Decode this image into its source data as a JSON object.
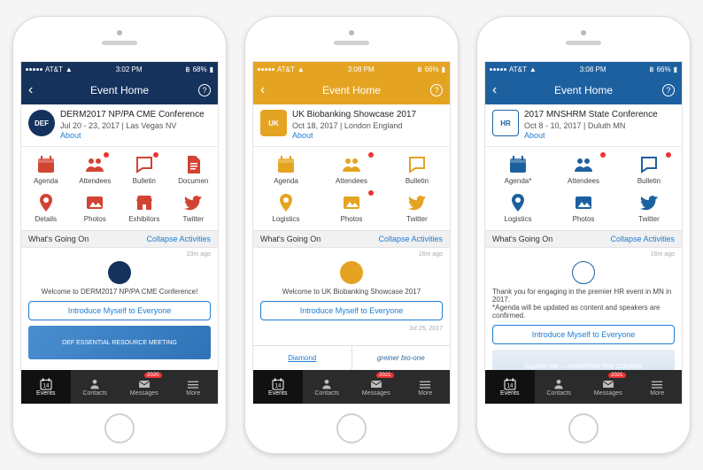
{
  "phones": [
    {
      "accent": "#15325c",
      "iconColor": "#d14433",
      "status": {
        "carrier": "AT&T",
        "time": "3:02 PM",
        "battery": "68%"
      },
      "navTitle": "Event Home",
      "event": {
        "title": "DERM2017 NP/PA CME Conference",
        "dates": "Jul 20 - 23, 2017 | Las Vegas NV",
        "about": "About",
        "logoText": "DEF",
        "logoBg": "#15325c",
        "logoShape": "circle"
      },
      "grid": [
        {
          "name": "agenda",
          "label": "Agenda",
          "badge": false
        },
        {
          "name": "attendees",
          "label": "Attendees",
          "badge": true
        },
        {
          "name": "bulletin",
          "label": "Bulletin",
          "badge": true
        },
        {
          "name": "documents",
          "label": "Documen",
          "badge": false
        },
        {
          "name": "details",
          "label": "Details",
          "badge": false
        },
        {
          "name": "photos",
          "label": "Photos",
          "badge": false
        },
        {
          "name": "exhibitors",
          "label": "Exhibitors",
          "badge": false
        },
        {
          "name": "twitter",
          "label": "Twitter",
          "badge": false
        }
      ],
      "gridCols": 4,
      "wgo": {
        "title": "What's Going On",
        "collapse": "Collapse Activities"
      },
      "feed": {
        "time": "23m ago",
        "text": "Welcome to DERM2017 NP/PA CME Conference!",
        "intro": "Introduce Myself to Everyone",
        "bannerBg": "linear-gradient(135deg,#4a8fd1,#2e72b6)",
        "bannerText": "DEF ESSENTIAL RESOURCE MEETING"
      },
      "tabs": {
        "items": [
          "Events",
          "Contacts",
          "Messages",
          "More"
        ],
        "active": 0,
        "calendarDay": "14",
        "msgBadge": "2020"
      }
    },
    {
      "accent": "#e4a422",
      "iconColor": "#e4a422",
      "status": {
        "carrier": "AT&T",
        "time": "3:08 PM",
        "battery": "66%"
      },
      "navTitle": "Event Home",
      "event": {
        "title": "UK Biobanking Showcase 2017",
        "dates": "Oct 18, 2017 | London England",
        "about": "About",
        "logoText": "UK",
        "logoBg": "#e4a422",
        "logoShape": "square"
      },
      "grid": [
        {
          "name": "agenda",
          "label": "Agenda",
          "badge": false
        },
        {
          "name": "attendees",
          "label": "Attendees",
          "badge": true
        },
        {
          "name": "bulletin",
          "label": "Bulletin",
          "badge": false
        },
        {
          "name": "logistics",
          "label": "Logistics",
          "badge": false
        },
        {
          "name": "photos",
          "label": "Photos",
          "badge": true
        },
        {
          "name": "twitter",
          "label": "Twitter",
          "badge": false
        }
      ],
      "gridCols": 3,
      "wgo": {
        "title": "What's Going On",
        "collapse": "Collapse Activities"
      },
      "feed": {
        "time": "16m ago",
        "text": "Welcome to UK Biobanking Showcase 2017",
        "intro": "Introduce Myself to Everyone",
        "subtime": "Jul 25, 2017"
      },
      "sponsor": {
        "left": "Diamond",
        "right": "greiner bio-one"
      },
      "tabs": {
        "items": [
          "Events",
          "Contacts",
          "Messages",
          "More"
        ],
        "active": 0,
        "calendarDay": "14",
        "msgBadge": "2021"
      }
    },
    {
      "accent": "#1d60a0",
      "iconColor": "#1d60a0",
      "status": {
        "carrier": "AT&T",
        "time": "3:08 PM",
        "battery": "66%"
      },
      "navTitle": "Event Home",
      "event": {
        "title": "2017 MNSHRM State Conference",
        "dates": "Oct 8 - 10, 2017 | Duluth MN",
        "about": "About",
        "logoText": "HR",
        "logoBg": "#fff",
        "logoShape": "square",
        "logoBorder": "#1d60a0"
      },
      "grid": [
        {
          "name": "agenda",
          "label": "Agenda*",
          "badge": false
        },
        {
          "name": "attendees",
          "label": "Attendees",
          "badge": true
        },
        {
          "name": "bulletin",
          "label": "Bulletin",
          "badge": true
        },
        {
          "name": "logistics",
          "label": "Logistics",
          "badge": false
        },
        {
          "name": "photos",
          "label": "Photos",
          "badge": false
        },
        {
          "name": "twitter",
          "label": "Twitter",
          "badge": false
        }
      ],
      "gridCols": 3,
      "wgo": {
        "title": "What's Going On",
        "collapse": "Collapse Activities"
      },
      "feed": {
        "time": "16m ago",
        "text": "Thank you for engaging in the premier HR event in MN in 2017.\n*Agenda will be updated as content and speakers are confirmed.",
        "intro": "Introduce Myself to Everyone",
        "bannerBg": "linear-gradient(#e8eef5,#d6e3f1)",
        "bannerText": "Superior HR — CHARTING THE COURSE"
      },
      "tabs": {
        "items": [
          "Events",
          "Contacts",
          "Messages",
          "More"
        ],
        "active": 0,
        "calendarDay": "14",
        "msgBadge": "2021"
      }
    }
  ],
  "icons": {
    "agenda": "cal",
    "attendees": "people",
    "bulletin": "chat",
    "documents": "doc",
    "details": "pin",
    "logistics": "pin",
    "photos": "photo",
    "exhibitors": "store",
    "twitter": "twitter"
  }
}
